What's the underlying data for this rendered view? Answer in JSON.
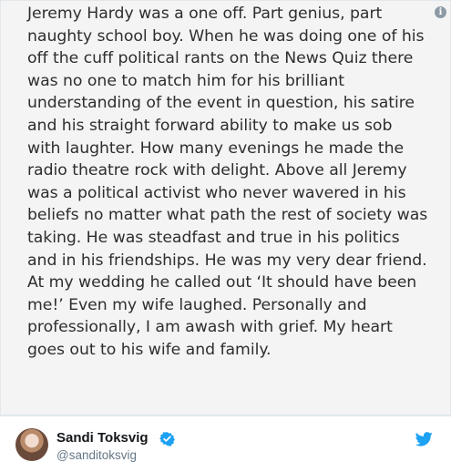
{
  "tweet_image": {
    "text": "Jeremy Hardy was a one off. Part genius, part naughty school boy. When he was doing one of his off the cuff political rants on the News Quiz there was no one to match him for his brilliant understanding of the event in question, his satire and his straight forward ability to make us sob with laughter. How many evenings he made the radio theatre rock with delight. Above all Jeremy was a political activist who never wavered in his beliefs no matter what path the rest of society was taking. He was steadfast and true in his politics and in his friendships. He was my very dear friend. At my wedding he called out ‘It should have been me!’ Even my wife laughed. Personally and professionally, I am awash with grief. My heart goes out to his wife and family.",
    "info_icon_glyph": "i"
  },
  "author": {
    "name": "Sandi Toksvig",
    "handle": "@sanditoksvig",
    "verified": true
  },
  "icons": {
    "info": "info-icon",
    "verified": "verified-badge-icon",
    "brand": "twitter-bird-icon"
  },
  "colors": {
    "image_background": "#f4f4f4",
    "image_text": "#2e2e2e",
    "name": "#14171a",
    "handle": "#657786",
    "twitter_blue": "#1da1f2",
    "border": "#e1e8ed"
  }
}
